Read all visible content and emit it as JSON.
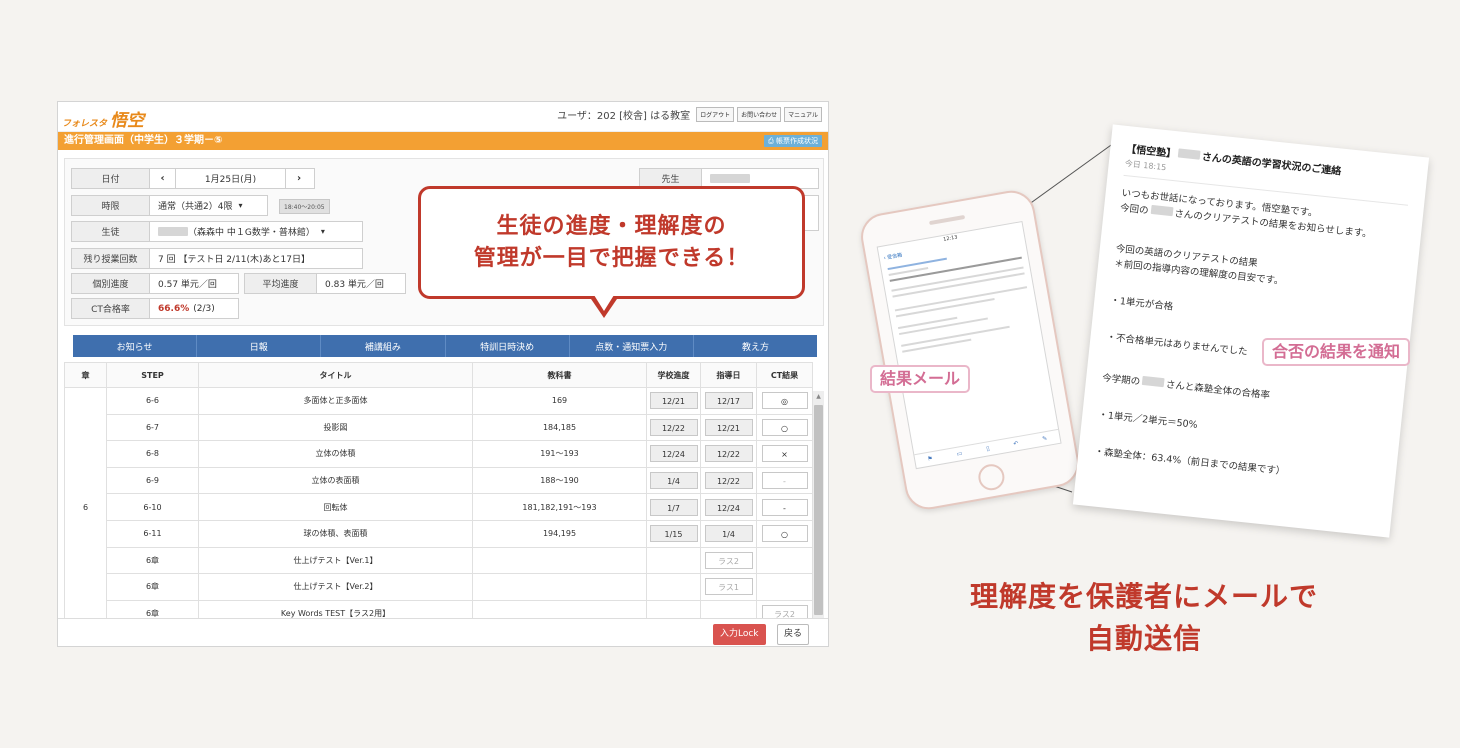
{
  "app": {
    "logo_small": "フォレスタ",
    "logo_big": "悟空",
    "user_label": "ユーザ：202 [校舎] はる教室",
    "buttons": [
      "ログアウト",
      "お問い合わせ",
      "マニュアル"
    ],
    "title": "進行管理画面（中学生）３学期－⑤",
    "report_button": "帳票作成状況"
  },
  "info": {
    "date_label": "日付",
    "date_prev": "‹",
    "date_value": "1月25日(月)",
    "date_next": "›",
    "period_label": "時限",
    "period_value": "通常（共通2）4限",
    "period_time": "18:40～20:05",
    "student_label": "生徒",
    "student_value": "（森森中 中１G数学・普林館）",
    "remaining_label": "残り授業回数",
    "remaining_value": "7 回 【テスト日 2/11(木)あと17日】",
    "individual_label": "個別進度",
    "individual_value": "0.57 単元／回",
    "average_label": "平均進度",
    "average_value": "0.83 単元／回",
    "ct_label": "CT合格率",
    "ct_value": "66.6%",
    "ct_count": "(2/3)",
    "teacher_label": "先生"
  },
  "tabs": [
    "お知らせ",
    "日報",
    "補講組み",
    "特訓日時決め",
    "点数・通知票入力",
    "教え方"
  ],
  "table": {
    "headers": [
      "章",
      "STEP",
      "タイトル",
      "教科書",
      "学校進度",
      "指導日",
      "CT結果"
    ],
    "chapter": "6",
    "rows": [
      {
        "step": "6-6",
        "title": "多面体と正多面体",
        "book": "169",
        "school": "12/21",
        "date": "12/17",
        "ct": "◎"
      },
      {
        "step": "6-7",
        "title": "投影図",
        "book": "184,185",
        "school": "12/22",
        "date": "12/21",
        "ct": "○"
      },
      {
        "step": "6-8",
        "title": "立体の体積",
        "book": "191～193",
        "school": "12/24",
        "date": "12/22",
        "ct": "×"
      },
      {
        "step": "6-9",
        "title": "立体の表面積",
        "book": "188～190",
        "school": "1/4",
        "date": "12/22",
        "ct": "-"
      },
      {
        "step": "6-10",
        "title": "回転体",
        "book": "181,182,191～193",
        "school": "1/7",
        "date": "12/24",
        "ct": "-"
      },
      {
        "step": "6-11",
        "title": "球の体積、表面積",
        "book": "194,195",
        "school": "1/15",
        "date": "1/4",
        "ct": "○"
      },
      {
        "step": "6章",
        "title": "仕上げテスト【Ver.1】",
        "book": "",
        "school": "",
        "date": "ラス2",
        "ct": ""
      },
      {
        "step": "6章",
        "title": "仕上げテスト【Ver.2】",
        "book": "",
        "school": "",
        "date": "ラス1",
        "ct": ""
      },
      {
        "step": "6章",
        "title": "Key Words TEST【ラス2用】",
        "book": "",
        "school": "",
        "date": "",
        "ct": "ラス2"
      }
    ]
  },
  "footer": {
    "lock_button": "入力Lock",
    "back_button": "戻る"
  },
  "callout": {
    "line1": "生徒の進度・理解度の",
    "line2": "管理が一目で把握できる！"
  },
  "phone": {
    "status_time": "12:13",
    "back_label": "‹ 受信箱"
  },
  "email": {
    "subject_prefix": "【悟空塾】",
    "subject_suffix": "さんの英語の学習状況のご連絡",
    "time": "今日 18:15",
    "greeting": "いつもお世話になっております。悟空塾です。",
    "intro_prefix": "今回の",
    "intro_suffix": "さんのクリアテストの結果をお知らせします。",
    "result_heading": "今回の英語のクリアテストの結果",
    "result_note": "＊前回の指導内容の理解度の目安です。",
    "pass_item": "・1単元が合格",
    "fail_item": "・不合格単元はありませんでした",
    "rate_prefix": "今学期の",
    "rate_suffix": "さんと森塾全体の合格率",
    "student_rate": "・1単元／2単元＝50%",
    "school_rate": "・森塾全体：63.4%（前日までの結果です）"
  },
  "labels": {
    "mail": "結果メール",
    "result": "合否の結果を通知"
  },
  "bottom": {
    "line1": "理解度を保護者にメールで",
    "line2": "自動送信"
  },
  "colors": {
    "orange": "#f3a033",
    "navy": "#3f6fae",
    "red": "#c0392b",
    "pink": "#d36d94"
  }
}
